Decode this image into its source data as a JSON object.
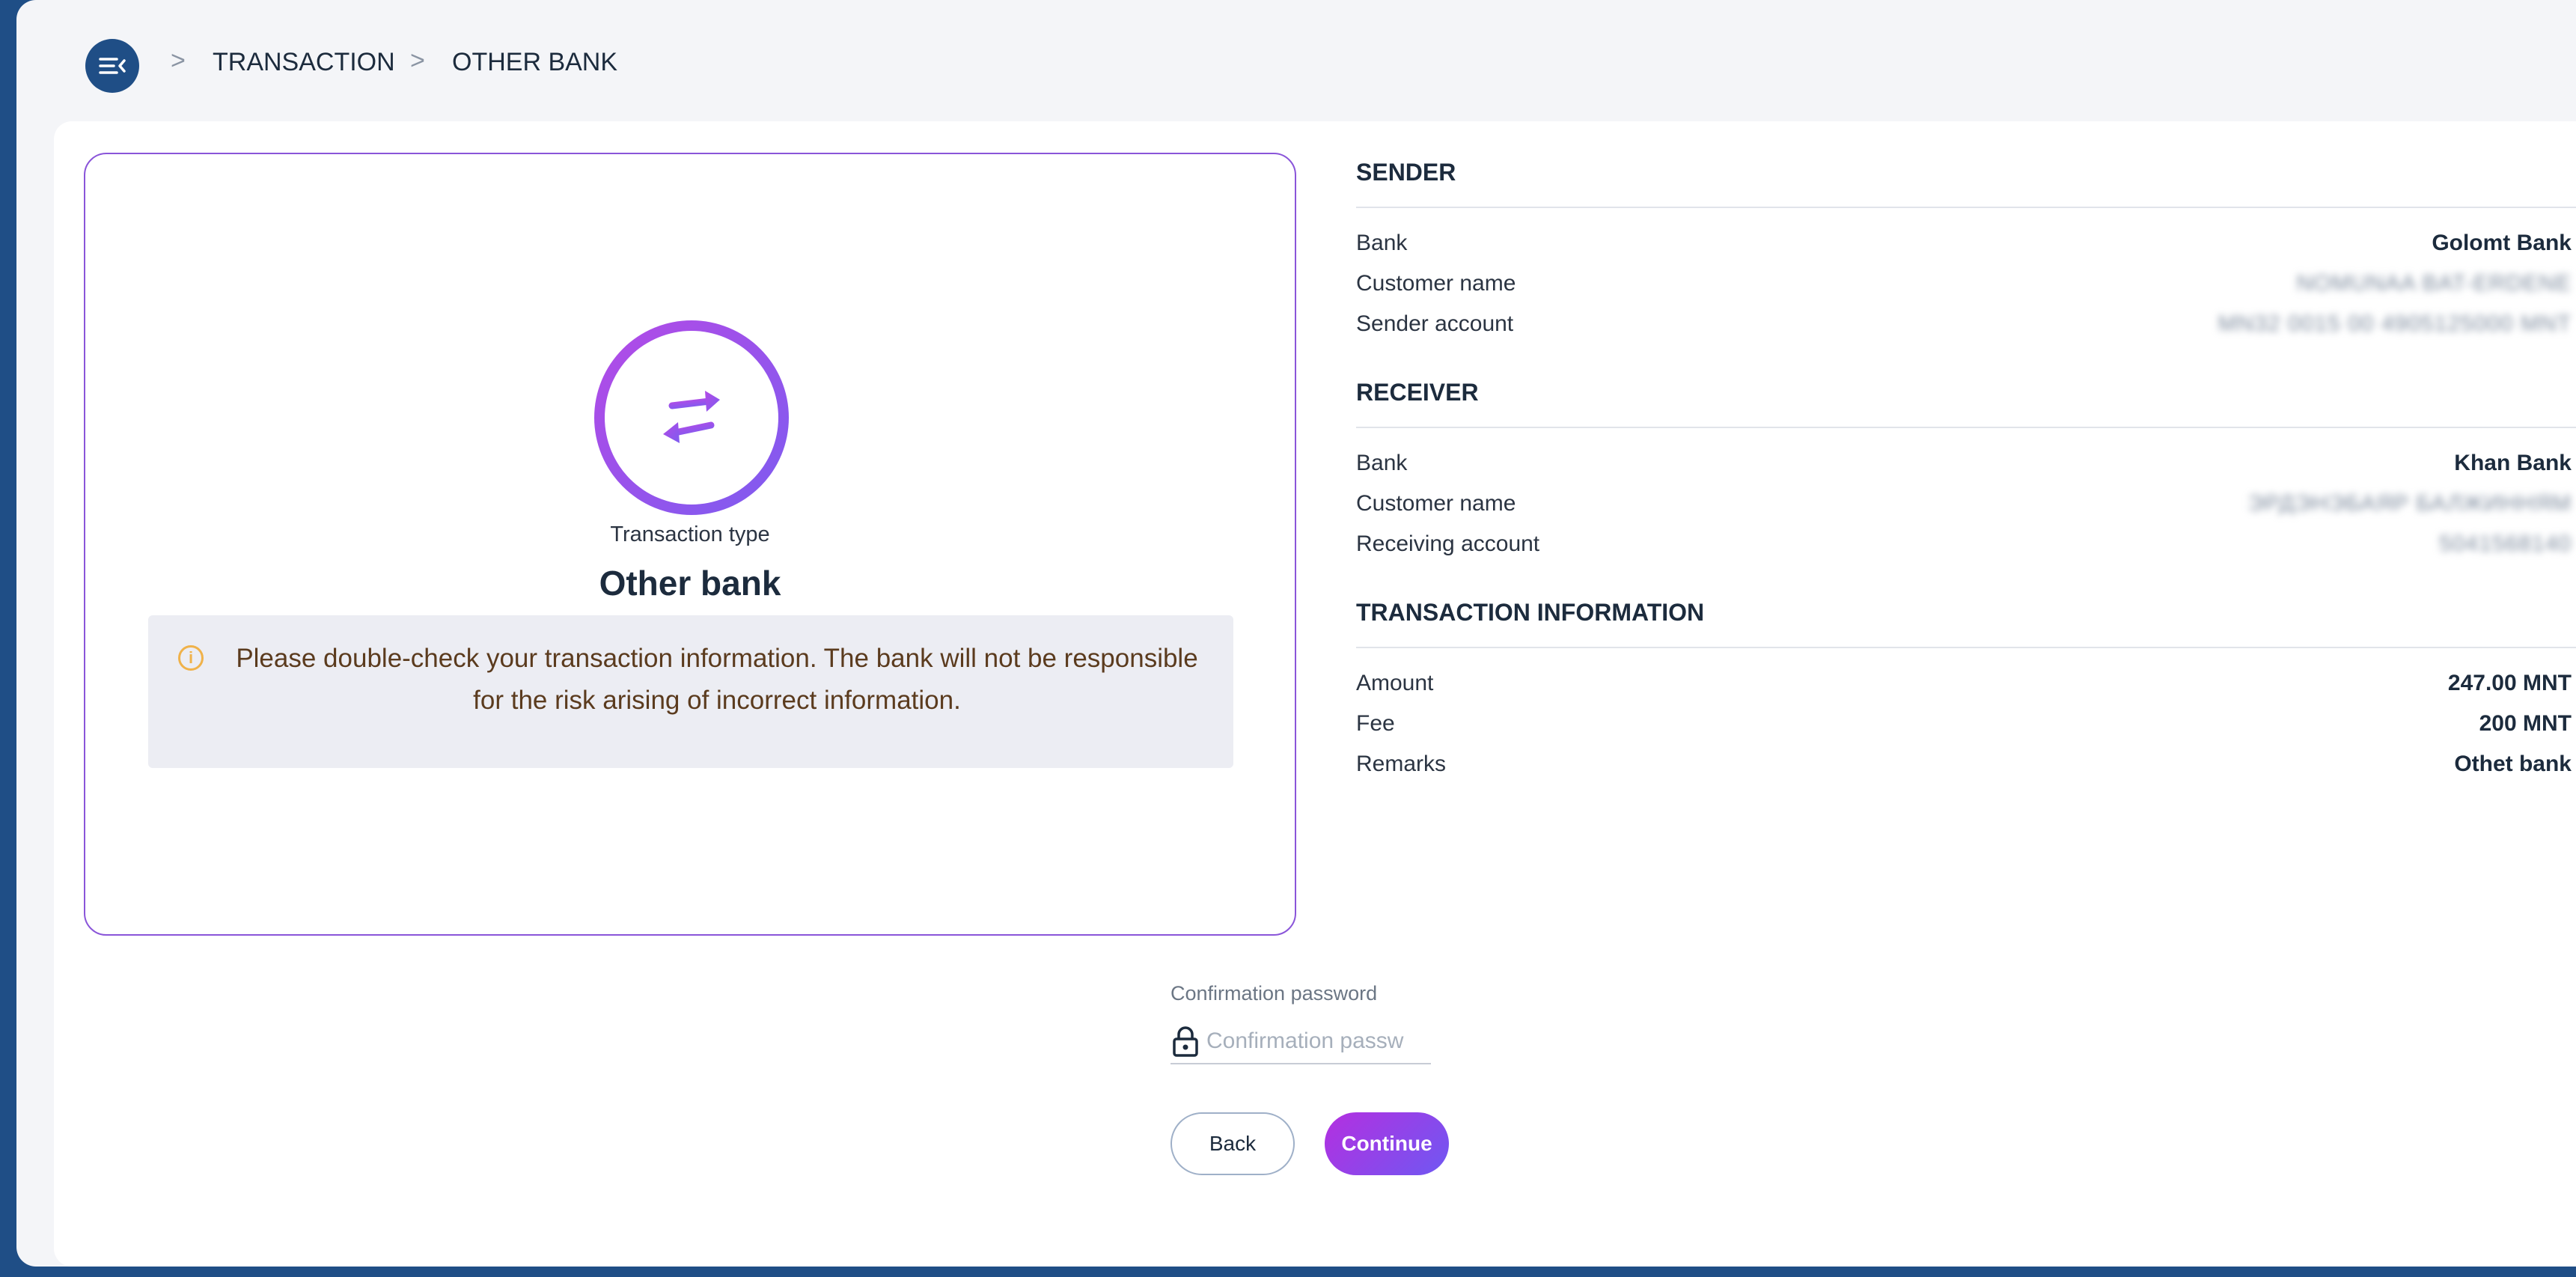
{
  "breadcrumb": {
    "items": [
      "TRANSACTION",
      "OTHER BANK"
    ],
    "separator": ">"
  },
  "transaction_type": {
    "label": "Transaction type",
    "value": "Other bank"
  },
  "notice": {
    "text": "Please double-check your transaction information. The bank will not be responsible for the risk arising of incorrect information."
  },
  "sender": {
    "title": "SENDER",
    "rows": [
      {
        "label": "Bank",
        "value": "Golomt Bank"
      },
      {
        "label": "Customer name",
        "value": "NOMUNAA BAT-ERDENE"
      },
      {
        "label": "Sender account",
        "value": "MN32 0015 00 4905125000 MNT"
      }
    ]
  },
  "receiver": {
    "title": "RECEIVER",
    "rows": [
      {
        "label": "Bank",
        "value": "Khan Bank"
      },
      {
        "label": "Customer name",
        "value": "ЭРДЭНЭБАЯР БАЛЖИННЯМ"
      },
      {
        "label": "Receiving account",
        "value": "5041568140"
      }
    ]
  },
  "transaction_info": {
    "title": "TRANSACTION INFORMATION",
    "rows": [
      {
        "label": "Amount",
        "value": "247.00 MNT"
      },
      {
        "label": "Fee",
        "value": "200 MNT"
      },
      {
        "label": "Remarks",
        "value": "Othet bank"
      }
    ]
  },
  "password": {
    "label": "Confirmation password",
    "placeholder": "Confirmation passw",
    "value": ""
  },
  "buttons": {
    "back": "Back",
    "continue": "Continue"
  },
  "colors": {
    "brand_blue": "#1f4e86",
    "accent_purple": "#8a55d9",
    "warning": "#f0b24a"
  },
  "icons": {
    "menu": "menu-collapse-icon",
    "transfer": "transfer-arrows-icon",
    "info": "info-circle-icon",
    "lock": "lock-icon"
  }
}
